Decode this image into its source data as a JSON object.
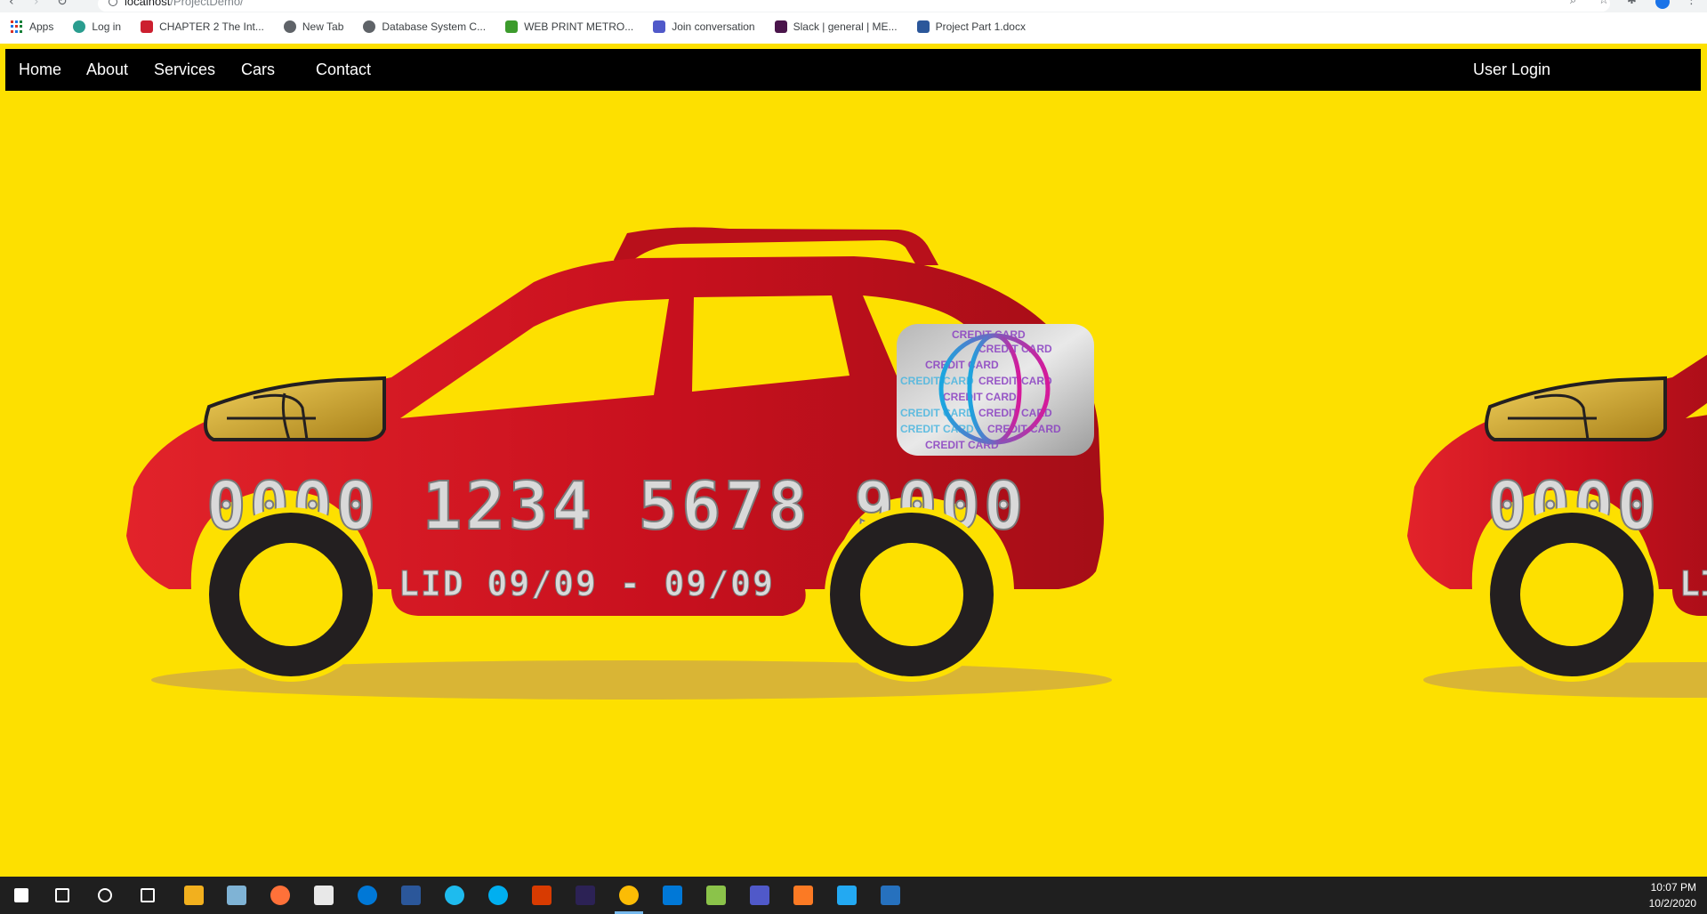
{
  "browser": {
    "url_host": "localhost",
    "url_path": "/ProjectDemo/",
    "icons": [
      "back-icon",
      "forward-icon",
      "reload-icon",
      "search-icon",
      "star-icon",
      "extensions-icon",
      "profile-avatar",
      "menu-kebab-icon"
    ]
  },
  "bookmarks": [
    {
      "label": "Apps",
      "icon": "apps-grid-icon",
      "color": "#1a73e8"
    },
    {
      "label": "Log in",
      "icon": "globe-icon",
      "color": "#2a9d8f"
    },
    {
      "label": "CHAPTER 2 The Int...",
      "icon": "opera-icon",
      "color": "#cc1f2f"
    },
    {
      "label": "New Tab",
      "icon": "globe-icon",
      "color": "#5f6368"
    },
    {
      "label": "Database System C...",
      "icon": "globe-icon",
      "color": "#5f6368"
    },
    {
      "label": "WEB PRINT METRO...",
      "icon": "printer-icon",
      "color": "#3c9b2c"
    },
    {
      "label": "Join conversation",
      "icon": "teams-icon",
      "color": "#5059c9"
    },
    {
      "label": "Slack | general | ME...",
      "icon": "slack-icon",
      "color": "#4a154b"
    },
    {
      "label": "Project Part 1.docx",
      "icon": "word-icon",
      "color": "#2b579a"
    }
  ],
  "navbar": {
    "links": [
      "Home",
      "About",
      "Services",
      "Cars",
      "Contact"
    ],
    "login": "User Login"
  },
  "hero": {
    "card_number": "0000 1234 5678 9000",
    "valid_text": "LID 09/09 - 09/09",
    "hologram_text": "CREDIT CARD",
    "repeat_card_number": "0000",
    "repeat_valid_text": "LI",
    "colors": {
      "background": "#fde000",
      "car_body": "#c8101e",
      "car_shadow": "#e2232a",
      "tyre": "#231f20",
      "chip": "#c9a227"
    }
  },
  "taskbar": {
    "apps": [
      {
        "name": "start-button",
        "color": "#ffffff"
      },
      {
        "name": "search-icon",
        "color": "#ffffff"
      },
      {
        "name": "cortana-icon",
        "color": "#ffffff"
      },
      {
        "name": "task-view-icon",
        "color": "#ffffff"
      },
      {
        "name": "file-explorer-icon",
        "color": "#f2b01e"
      },
      {
        "name": "paint-icon",
        "color": "#7fb3d5"
      },
      {
        "name": "firefox-icon",
        "color": "#ff7139"
      },
      {
        "name": "store-icon",
        "color": "#e8e8e8"
      },
      {
        "name": "edge-icon",
        "color": "#0078d7"
      },
      {
        "name": "word-icon",
        "color": "#2b579a"
      },
      {
        "name": "ie-icon",
        "color": "#1ebbee"
      },
      {
        "name": "skype-icon",
        "color": "#00aff0"
      },
      {
        "name": "office-icon",
        "color": "#d83b01"
      },
      {
        "name": "eclipse-icon",
        "color": "#2c2255"
      },
      {
        "name": "chrome-icon",
        "color": "#fbbc05"
      },
      {
        "name": "mail-icon",
        "color": "#0078d7"
      },
      {
        "name": "notepadpp-icon",
        "color": "#8bc34a"
      },
      {
        "name": "teams-icon",
        "color": "#5059c9"
      },
      {
        "name": "xampp-icon",
        "color": "#fb7a24"
      },
      {
        "name": "vscode-icon",
        "color": "#23a9f2"
      },
      {
        "name": "powershell-icon",
        "color": "#2671be"
      }
    ],
    "time": "10:07 PM",
    "date": "10/2/2020"
  }
}
